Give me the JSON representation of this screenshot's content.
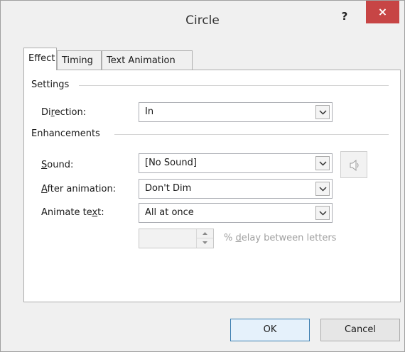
{
  "dialog": {
    "title": "Circle",
    "help_label": "?",
    "close_label": "×"
  },
  "tabs": [
    {
      "label": "Effect",
      "active": true
    },
    {
      "label": "Timing",
      "active": false
    },
    {
      "label": "Text Animation",
      "active": false
    }
  ],
  "settings": {
    "group_label": "Settings",
    "direction_label_pre": "Di",
    "direction_label_u": "r",
    "direction_label_post": "ection:",
    "direction_value": "In"
  },
  "enhancements": {
    "group_label": "Enhancements",
    "sound_label_u": "S",
    "sound_label_post": "ound:",
    "sound_value": "[No Sound]",
    "after_label_u": "A",
    "after_label_post": "fter animation:",
    "after_value": "Don't Dim",
    "animate_label_pre": "Animate te",
    "animate_label_u": "x",
    "animate_label_post": "t:",
    "animate_value": "All at once",
    "delay_label_pre": "% ",
    "delay_label_u": "d",
    "delay_label_post": "elay between letters",
    "delay_value": ""
  },
  "buttons": {
    "ok": "OK",
    "cancel": "Cancel"
  }
}
